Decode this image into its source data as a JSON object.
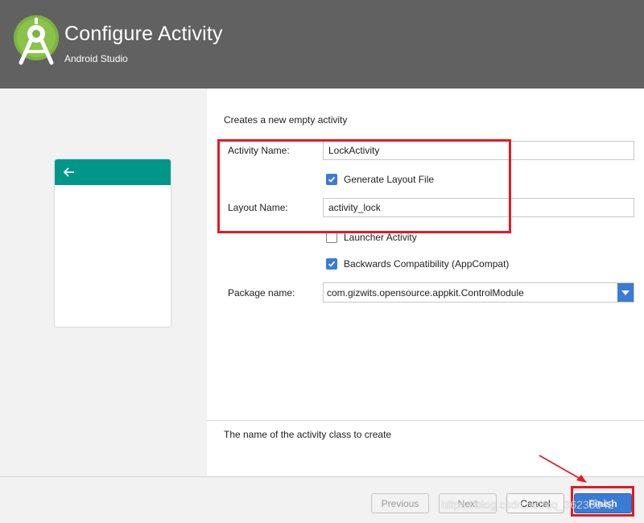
{
  "header": {
    "title": "Configure Activity",
    "subtitle": "Android Studio",
    "logo_icon": "android-studio-logo"
  },
  "preview": {
    "back_icon": "arrow-left-icon",
    "bar_color": "#00968a"
  },
  "form": {
    "description": "Creates a new empty activity",
    "activity_name_label": "Activity Name:",
    "activity_name_value": "LockActivity",
    "generate_layout_label": "Generate Layout File",
    "generate_layout_checked": true,
    "layout_name_label": "Layout Name:",
    "layout_name_value": "activity_lock",
    "launcher_activity_label": "Launcher Activity",
    "launcher_activity_checked": false,
    "backwards_compat_label": "Backwards Compatibility (AppCompat)",
    "backwards_compat_checked": true,
    "package_name_label": "Package name:",
    "package_name_value": "com.gizwits.opensource.appkit.ControlModule"
  },
  "hint": "The name of the activity class to create",
  "buttons": {
    "previous": "Previous",
    "next": "Next",
    "cancel": "Cancel",
    "finish": "Finish"
  },
  "watermark": "https://blog.csdn.net/qq_36233942",
  "colors": {
    "header_bg": "#616161",
    "accent_blue": "#3a7bd5",
    "annotation_red": "#e31b23"
  }
}
